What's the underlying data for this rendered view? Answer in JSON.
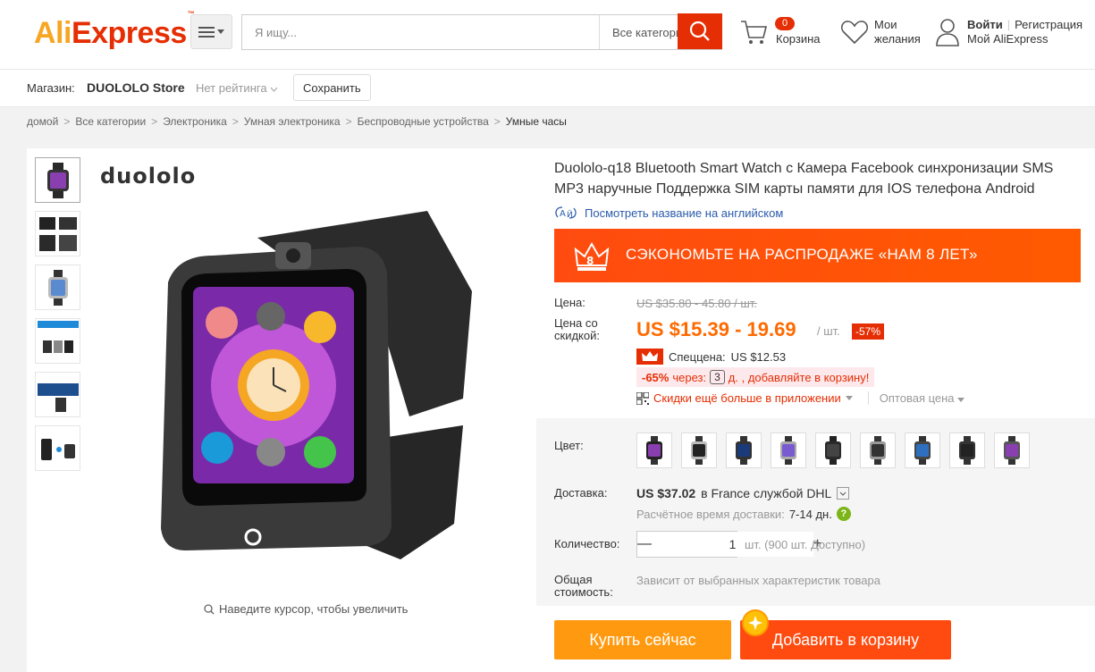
{
  "header": {
    "logo_ali": "Ali",
    "logo_express": "Express",
    "logo_tm": "™",
    "search_placeholder": "Я ищу...",
    "category_select": "Все категории",
    "cart_count": "0",
    "cart_label": "Корзина",
    "wishlist_line1": "Мои",
    "wishlist_line2": "желания",
    "login": "Войти",
    "register": "Регистрация",
    "my_account": "Мой AliExpress"
  },
  "store": {
    "label": "Магазин:",
    "name": "DUOLOLO Store",
    "rating": "Нет рейтинга",
    "save_button": "Сохранить"
  },
  "breadcrumb": {
    "items": [
      "домой",
      "Все категории",
      "Электроника",
      "Умная электроника",
      "Беспроводные устройства"
    ],
    "current": "Умные часы",
    "separator": ">"
  },
  "gallery": {
    "brand": "duololo",
    "zoom_hint": "Наведите курсор, чтобы увеличить"
  },
  "product": {
    "title": "Duololo-q18 Bluetooth Smart Watch с Камера Facebook синхронизации SMS MP3 наручные Поддержка SIM карты памяти для IOS телефона Android",
    "translate_link": "Посмотреть название на английском",
    "promo_banner": "СЭКОНОМЬТЕ НА РАСПРОДАЖЕ «НАМ 8 ЛЕТ»",
    "price_label": "Цена:",
    "old_price": "US $35.80 - 45.80 / шт.",
    "discount_label_1": "Цена со",
    "discount_label_2": "скидкой:",
    "new_price": "US $15.39 - 19.69",
    "per_unit": "/ шт.",
    "discount_badge": "-57%",
    "special_price_label": "Спеццена:",
    "special_price": "US $12.53",
    "coupon_pct": "-65%",
    "coupon_through": "через:",
    "coupon_days": "3",
    "coupon_rest": "д. , добавляйте в корзину!",
    "app_discount": "Скидки ещё больше в приложении",
    "wholesale": "Оптовая цена",
    "color_label": "Цвет:",
    "delivery_label": "Доставка:",
    "shipping_price": "US $37.02",
    "shipping_carrier": "в France службой DHL",
    "eta_label": "Расчётное время доставки:",
    "eta_days": "7-14 дн.",
    "qty_label": "Количество:",
    "qty_value": "1",
    "qty_available": "шт. (900 шт. Доступно)",
    "total_label_1": "Общая",
    "total_label_2": "стоимость:",
    "total_value": "Зависит от выбранных характеристик товара",
    "buy_now": "Купить сейчас",
    "add_to_cart": "Добавить в корзину"
  },
  "colors": {
    "brand_red": "#e62e04",
    "brand_orange": "#f6a623",
    "price_orange": "#ff6a00",
    "buy_button": "#ff9a10",
    "cart_button": "#ff4b10",
    "link_blue": "#2a5bac"
  }
}
